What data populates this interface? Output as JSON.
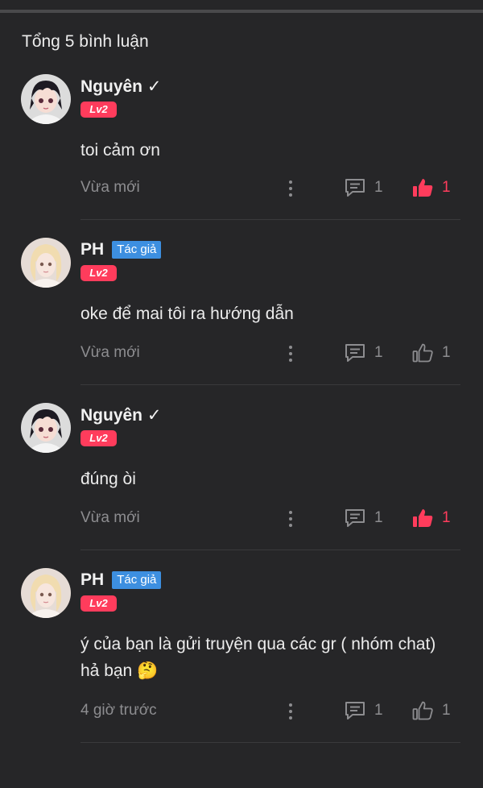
{
  "header": {
    "total_label": "Tổng 5 bình luận"
  },
  "comments": [
    {
      "avatar_icon": "dark-hair-character-avatar",
      "name": "Nguyên ✓",
      "author_badge": "",
      "level": "Lv2",
      "text": "toi cảm ơn",
      "time": "Vừa mới",
      "reply_count": "1",
      "like_count": "1",
      "liked": true
    },
    {
      "avatar_icon": "blonde-girl-avatar",
      "name": "PH",
      "author_badge": "Tác giả",
      "level": "Lv2",
      "text": "oke để mai tôi ra hướng dẫn",
      "time": "Vừa mới",
      "reply_count": "1",
      "like_count": "1",
      "liked": false
    },
    {
      "avatar_icon": "dark-hair-character-avatar",
      "name": "Nguyên ✓",
      "author_badge": "",
      "level": "Lv2",
      "text": "đúng òi",
      "time": "Vừa mới",
      "reply_count": "1",
      "like_count": "1",
      "liked": true
    },
    {
      "avatar_icon": "blonde-girl-avatar",
      "name": "PH",
      "author_badge": "Tác giả",
      "level": "Lv2",
      "text": "ý của bạn là gửi truyện qua các gr ( nhóm chat) hả bạn 🤔",
      "time": "4 giờ trước",
      "reply_count": "1",
      "like_count": "1",
      "liked": false
    }
  ],
  "colors": {
    "background": "#262628",
    "accent_red": "#ff3c5c",
    "author_blue": "#3d8fe0",
    "muted_text": "#8d8d90"
  }
}
